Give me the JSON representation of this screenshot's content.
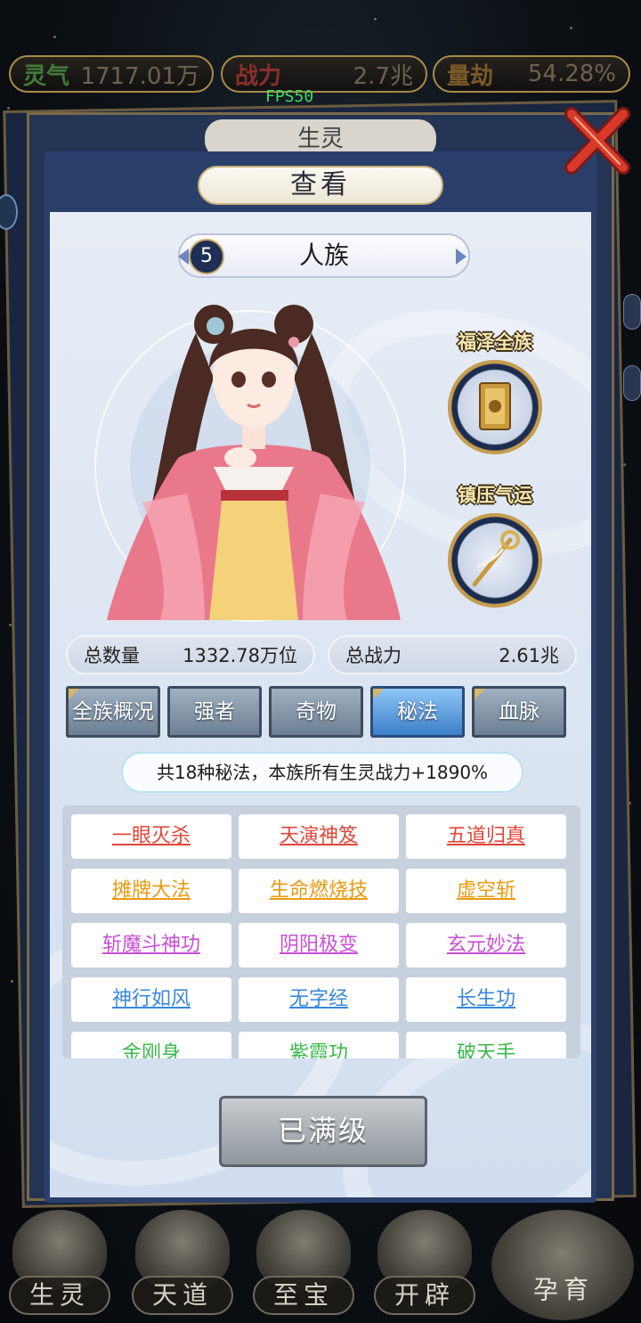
{
  "resources": [
    {
      "label": "灵气",
      "value": "1717.01万"
    },
    {
      "label": "战力",
      "value": "2.7兆"
    },
    {
      "label": "量劫",
      "value": "54.28%"
    }
  ],
  "fps": "FPS50",
  "back_title": "生灵",
  "panel": {
    "title": "查看",
    "race_level": "5",
    "race_name": "人族",
    "skills": [
      {
        "name": "福泽全族",
        "icon": "golden-card-icon"
      },
      {
        "name": "镇压气运",
        "icon": "golden-scepter-icon"
      }
    ],
    "stats": [
      {
        "label": "总数量",
        "value": "1332.78万位"
      },
      {
        "label": "总战力",
        "value": "2.61兆"
      }
    ],
    "tabs": [
      {
        "label": "全族概况",
        "active": false
      },
      {
        "label": "强者",
        "active": false
      },
      {
        "label": "奇物",
        "active": false
      },
      {
        "label": "秘法",
        "active": true
      },
      {
        "label": "血脉",
        "active": false
      }
    ],
    "summary": "共18种秘法，本族所有生灵战力+1890%",
    "arts": [
      {
        "name": "一眼灭杀",
        "color": "red"
      },
      {
        "name": "天演神笈",
        "color": "red"
      },
      {
        "name": "五道归真",
        "color": "red"
      },
      {
        "name": "摊牌大法",
        "color": "orange"
      },
      {
        "name": "生命燃烧技",
        "color": "orange"
      },
      {
        "name": "虚空斩",
        "color": "orange"
      },
      {
        "name": "斩魔斗神功",
        "color": "purple"
      },
      {
        "name": "阴阳极变",
        "color": "purple"
      },
      {
        "name": "玄元妙法",
        "color": "purple"
      },
      {
        "name": "神行如风",
        "color": "blue"
      },
      {
        "name": "无字经",
        "color": "blue"
      },
      {
        "name": "长生功",
        "color": "blue"
      },
      {
        "name": "金刚身",
        "color": "green"
      },
      {
        "name": "紫霞功",
        "color": "green"
      },
      {
        "name": "破天手",
        "color": "green"
      }
    ],
    "max_button": "已满级"
  },
  "bottom_nav": [
    {
      "label": "生灵"
    },
    {
      "label": "天道"
    },
    {
      "label": "至宝"
    },
    {
      "label": "开辟"
    },
    {
      "label": "孕育"
    }
  ],
  "colors": {
    "panel_border": "#2b3f6b",
    "tab_active": "#3c7fc8",
    "art_red": "#e0463a",
    "art_orange": "#e99a10",
    "art_purple": "#c94fd6",
    "art_blue": "#3a88d8",
    "art_green": "#3bb84a"
  }
}
